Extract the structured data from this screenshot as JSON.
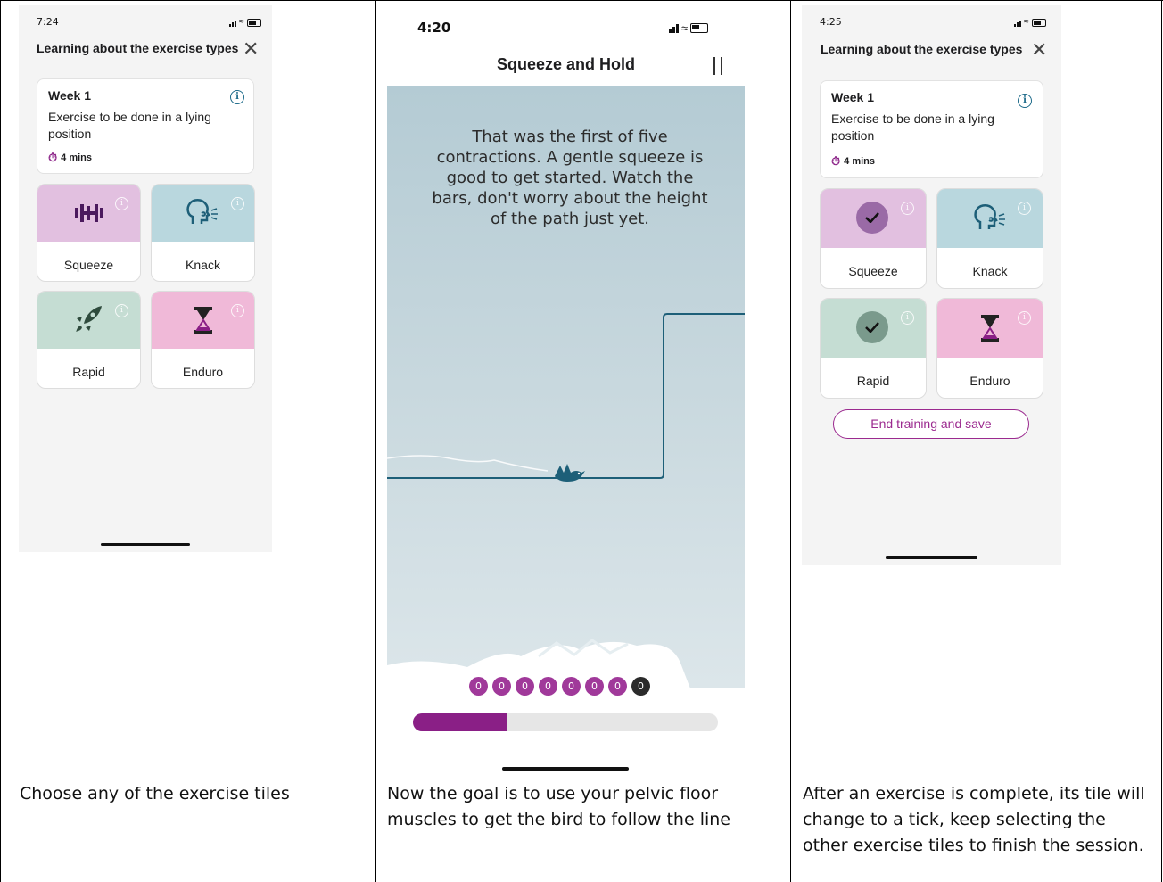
{
  "captions": {
    "col1": "Choose any of the exercise tiles",
    "col2": "Now the goal is to use your pelvic floor muscles to get the bird to follow the line",
    "col3": "After an exercise is complete, its tile will change to a tick, keep selecting the other exercise tiles to finish the session."
  },
  "screen1": {
    "time": "7:24",
    "title": "Learning about the exercise types",
    "week_title": "Week 1",
    "week_desc": "Exercise to be done in a lying position",
    "duration": "4 mins",
    "tiles": [
      {
        "label": "Squeeze",
        "icon": "dumbbell-icon",
        "color": "#e2c0e0"
      },
      {
        "label": "Knack",
        "icon": "head-cough-icon",
        "color": "#b9d7de"
      },
      {
        "label": "Rapid",
        "icon": "rocket-icon",
        "color": "#c5ddd3"
      },
      {
        "label": "Enduro",
        "icon": "hourglass-icon",
        "color": "#f0b9d8"
      }
    ]
  },
  "screen2": {
    "time": "4:20",
    "title": "Squeeze and Hold",
    "message": "That was the first of five contractions. A gentle squeeze is good to get started. Watch the bars, don't worry about the height of the path just yet.",
    "contractions": [
      "0",
      "0",
      "0",
      "0",
      "0",
      "0",
      "0",
      "0"
    ],
    "progress": 0.31
  },
  "screen3": {
    "time": "4:25",
    "title": "Learning about the exercise types",
    "week_title": "Week 1",
    "week_desc": "Exercise to be done in a lying position",
    "duration": "4 mins",
    "tiles": [
      {
        "label": "Squeeze",
        "icon": "check-icon",
        "color": "#e2c0e0",
        "completed": true
      },
      {
        "label": "Knack",
        "icon": "head-cough-icon",
        "color": "#b9d7de",
        "completed": false
      },
      {
        "label": "Rapid",
        "icon": "check-icon",
        "color": "#c5ddd3",
        "completed": true
      },
      {
        "label": "Enduro",
        "icon": "hourglass-icon",
        "color": "#f0b9d8",
        "completed": false
      }
    ],
    "end_button": "End training and save"
  },
  "colors": {
    "accent": "#9b2a8f",
    "info": "#1e6b8a",
    "line": "#1d5f78"
  }
}
